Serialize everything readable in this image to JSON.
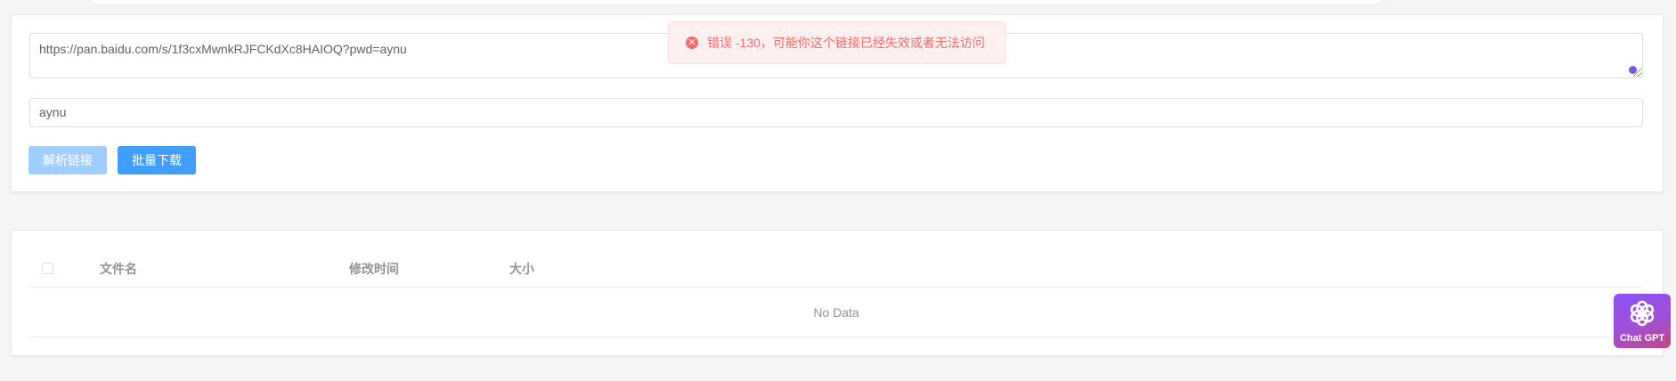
{
  "form": {
    "share_url": "https://pan.baidu.com/s/1f3cxMwnkRJFCKdXc8HAIOQ?pwd=aynu",
    "password": "aynu",
    "parse_button_label": "解析链接",
    "batch_download_label": "批量下载"
  },
  "table": {
    "columns": [
      "文件名",
      "修改时间",
      "大小"
    ],
    "empty_text": "No Data"
  },
  "message": {
    "text": "错误 -130，可能你这个链接已经失效或者无法访问",
    "type": "error",
    "color": "#f56c6c"
  },
  "widget": {
    "label": "Chat GPT",
    "icon": "openai-logo-icon"
  },
  "colors": {
    "primary": "#409eff",
    "primary_disabled": "#a0cfff",
    "error": "#f56c6c"
  }
}
